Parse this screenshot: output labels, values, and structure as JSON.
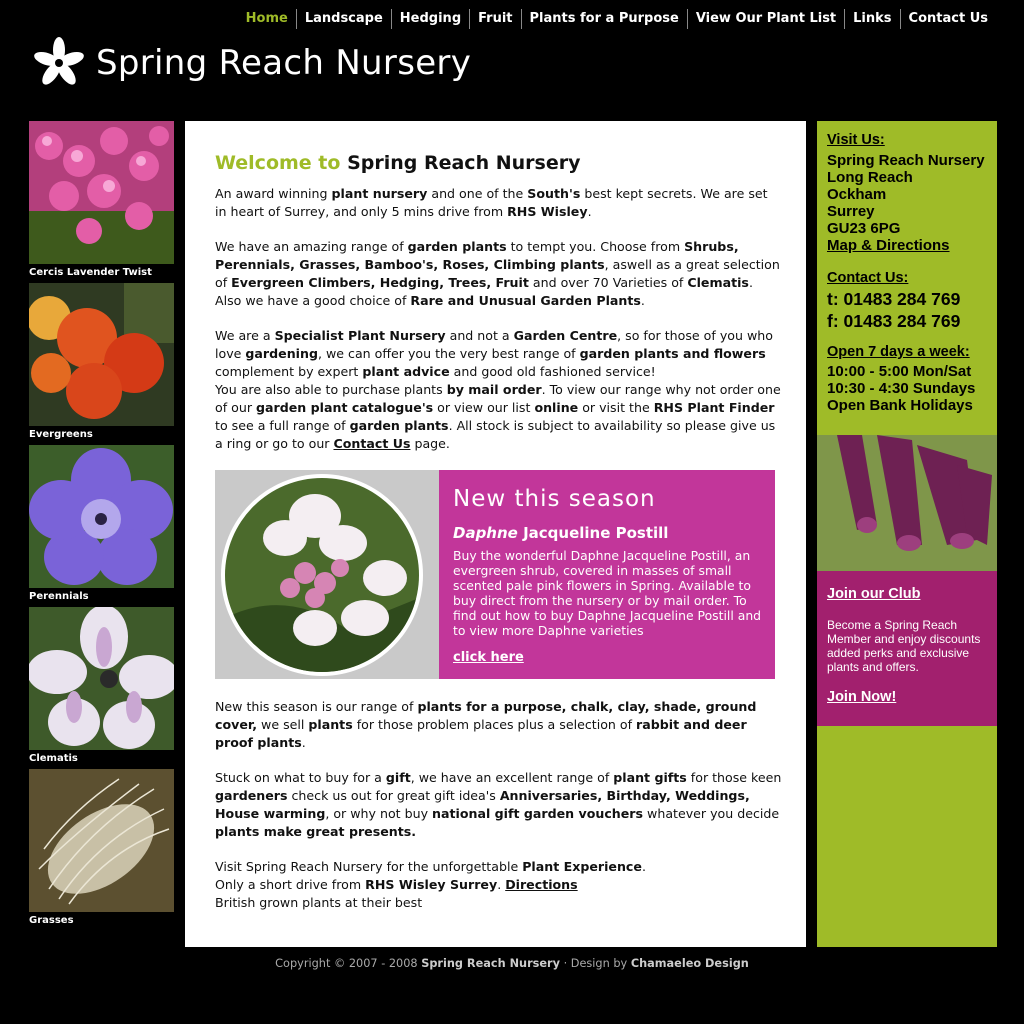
{
  "nav": {
    "items": [
      "Home",
      "Landscape",
      "Hedging",
      "Fruit",
      "Plants for a Purpose",
      "View Our Plant List",
      "Links",
      "Contact Us"
    ]
  },
  "logo": {
    "text": "Spring Reach Nursery",
    "icon": "flower-icon"
  },
  "left_thumbs": [
    {
      "label": "Cercis Lavender Twist"
    },
    {
      "label": "Evergreens"
    },
    {
      "label": "Perennials"
    },
    {
      "label": "Clematis"
    },
    {
      "label": "Grasses"
    }
  ],
  "main": {
    "heading_accent": "Welcome to",
    "heading_rest": "Spring Reach Nursery",
    "feature": {
      "title": "New this season",
      "name_italic": "Daphne",
      "name_rest": "Jacqueline Postill",
      "description": "Buy the wonderful Daphne Jacqueline Postill, an evergreen shrub, covered in masses of small scented pale pink flowers in Spring. Available to buy direct from the nursery or by mail order. To find out how to buy Daphne Jacqueline Postill and to view more Daphne varieties",
      "link": "click here"
    },
    "contact_link": "Contact Us",
    "directions_link": "Directions"
  },
  "right": {
    "visit_heading": "Visit Us:",
    "address": [
      "Spring Reach Nursery",
      "Long Reach",
      "Ockham",
      "Surrey",
      "GU23 6PG"
    ],
    "map_link": "Map & Directions",
    "contact_heading": "Contact Us:",
    "phone": "t: 01483 284 769",
    "fax": "f: 01483 284 769",
    "open_heading": "Open 7 days a week:",
    "hours": [
      "10:00 - 5:00 Mon/Sat",
      "10:30 - 4:30 Sundays",
      "Open Bank Holidays"
    ],
    "club_heading": "Join our Club",
    "club_text": "Become a Spring Reach Member and enjoy discounts added perks and exclusive plants and offers.",
    "club_link": "Join Now!"
  },
  "footer": {
    "prefix": "Copyright © 2007 - 2008",
    "site": "Spring Reach Nursery",
    "mid": "· Design by",
    "designer": "Chamaeleo Design"
  },
  "colors": {
    "accent_green": "#9fbb28",
    "accent_magenta": "#c2369a",
    "club_purple": "#a2206e"
  }
}
